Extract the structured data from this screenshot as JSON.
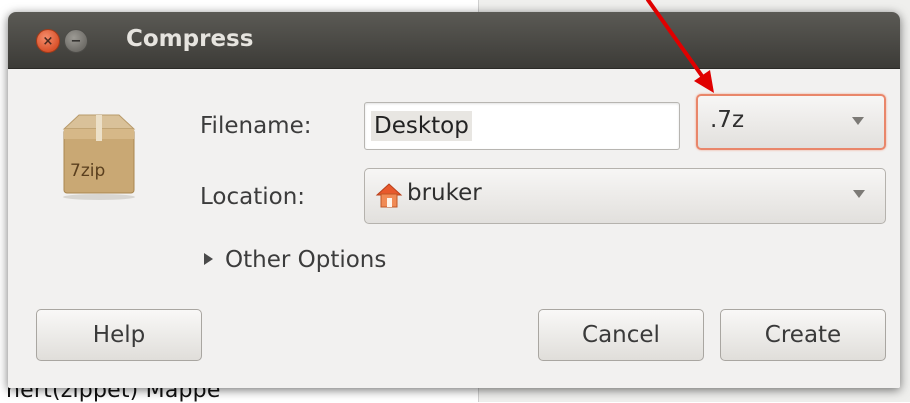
{
  "background": {
    "bottom_text": "nert(zippet) Mappe"
  },
  "dialog": {
    "title": "Compress",
    "close_glyph": "×",
    "minimize_glyph": "−",
    "icon_label": "7zip",
    "filename_label": "Filename:",
    "filename_value": "Desktop",
    "extension_value": ".7z",
    "location_label": "Location:",
    "location_value": "bruker",
    "other_options_label": "Other Options",
    "help_label": "Help",
    "cancel_label": "Cancel",
    "create_label": "Create"
  },
  "colors": {
    "titlebar": "#3c3b37",
    "close_button": "#e05b34",
    "focus_outline": "#e9866a",
    "annotation_arrow": "#e00000"
  }
}
